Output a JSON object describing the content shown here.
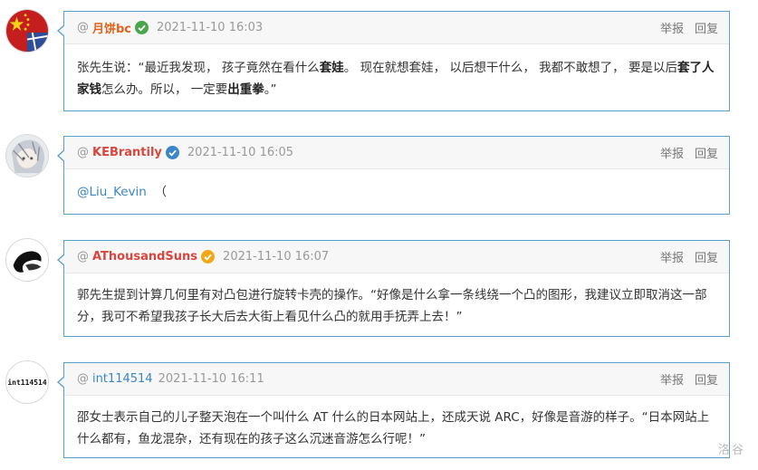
{
  "comments": [
    {
      "at": "@",
      "username": "月饼bc",
      "badge_color": "#4aa64a",
      "date": "2021-11-10 16:03",
      "report": "举报",
      "reply": "回复",
      "body_parts": [
        "张先生说：“最近我发现， 孩子竟然在看什么",
        "套娃",
        "。 现在就想套娃， 以后想干什么， 我都不敢想了， 要是以后",
        "套了人家钱",
        "怎么办。所以， 一定要",
        "出重拳",
        "。”"
      ]
    },
    {
      "at": "@",
      "username": "KEBrantily",
      "badge_color": "#3a86c8",
      "date": "2021-11-10 16:05",
      "report": "举报",
      "reply": "回复",
      "mention": "@Liu_Kevin",
      "trail": "（"
    },
    {
      "at": "@",
      "username": "AThousandSuns",
      "badge_color": "#f0a818",
      "date": "2021-11-10 16:07",
      "report": "举报",
      "reply": "回复",
      "body": "郭先生提到计算几何里有对凸包进行旋转卡壳的操作。“好像是什么拿一条线绕一个凸的图形，我建议立即取消这一部分，我可不希望我孩子长大后去大街上看见什么凸的就用手抚弄上去！”"
    },
    {
      "at": "@",
      "username": "int114514",
      "avatar_text": "int114514",
      "date": "2021-11-10 16:11",
      "report": "举报",
      "reply": "回复",
      "body": "邵女士表示自己的儿子整天泡在一个叫什么 AT 什么的日本网站上，还成天说 ARC，好像是音游的样子。“日本网站上什么都有，鱼龙混杂，还有现在的孩子这么沉迷音游怎么行呢！”"
    }
  ],
  "watermark": "洛谷"
}
